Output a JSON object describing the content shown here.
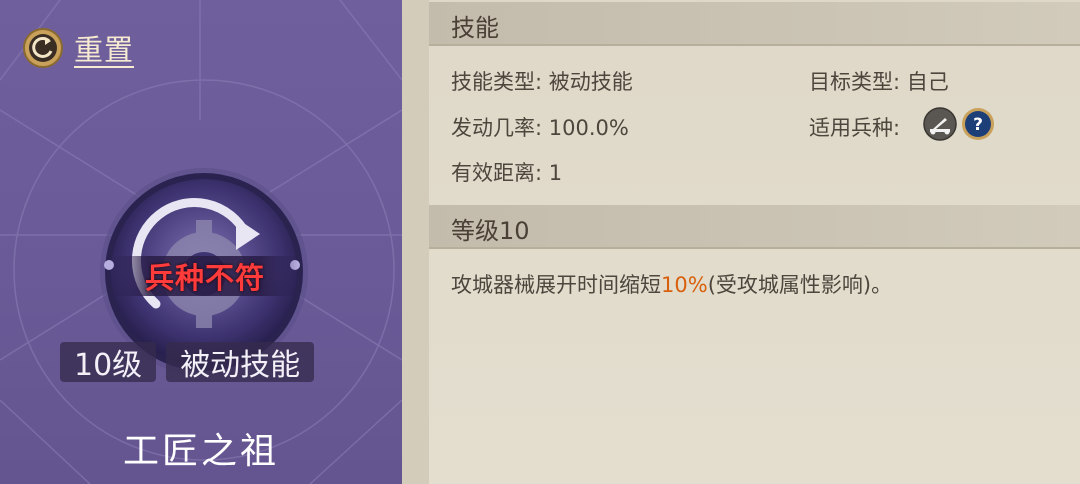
{
  "left": {
    "reset_label": "重置",
    "status": "兵种不符",
    "level_badge": "10级",
    "type_badge": "被动技能",
    "skill_name": "工匠之祖"
  },
  "skill_section": {
    "title": "技能",
    "skill_type": "技能类型: 被动技能",
    "target_type": "目标类型: 自己",
    "trigger_rate": "发动几率: 100.0%",
    "applicable_units": "适用兵种:",
    "range": "有效距离: 1"
  },
  "level_section": {
    "title": "等级10",
    "desc_before": "攻城器械展开时间缩短",
    "desc_value": "10%",
    "desc_after": "(受攻城属性影响)。"
  },
  "colors": {
    "left_bg": "#6a5b98",
    "right_bg": "#e2dccd",
    "status_red": "#ff3b3b",
    "highlight_orange": "#d8600c"
  },
  "icons": {
    "reset": "reset-circular-arrow-icon",
    "emblem": "gear-cycle-icon",
    "unit_1": "siege-unit-icon",
    "unit_2": "question-mark-icon"
  }
}
